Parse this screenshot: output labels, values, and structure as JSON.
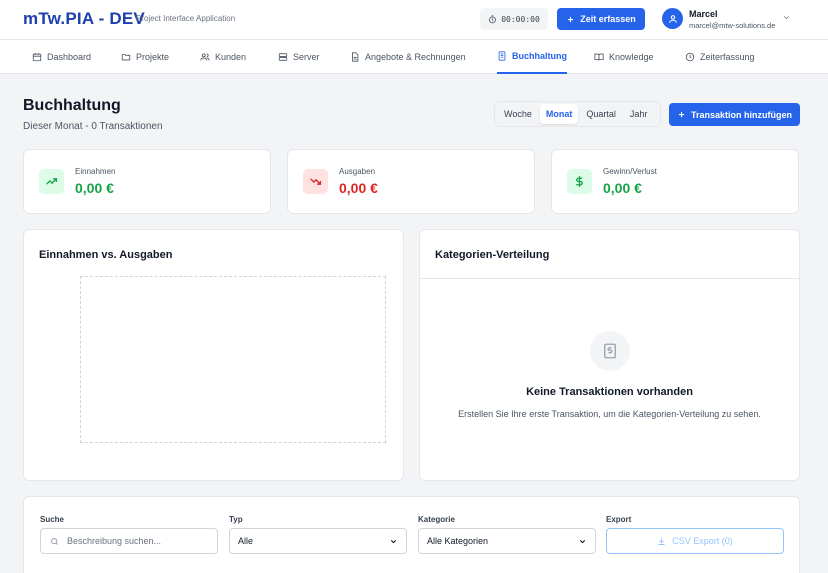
{
  "header": {
    "brand": "mTw.PIA - DEV",
    "brand_subtitle": "Project Interface Application",
    "timer": "00:00:00",
    "zeit_button": "Zeit erfassen",
    "user_name": "Marcel",
    "user_email": "marcel@mtw-solutions.de"
  },
  "nav": {
    "items": [
      {
        "label": "Dashboard",
        "icon": "calendar-icon"
      },
      {
        "label": "Projekte",
        "icon": "folder-icon"
      },
      {
        "label": "Kunden",
        "icon": "users-icon"
      },
      {
        "label": "Server",
        "icon": "server-icon"
      },
      {
        "label": "Angebote & Rechnungen",
        "icon": "document-icon"
      },
      {
        "label": "Buchhaltung",
        "icon": "receipt-icon"
      },
      {
        "label": "Knowledge",
        "icon": "book-icon"
      },
      {
        "label": "Zeiterfassung",
        "icon": "clock-icon"
      }
    ],
    "active": "Buchhaltung"
  },
  "page": {
    "title": "Buchhaltung",
    "subtitle": "Dieser Monat - 0 Transaktionen",
    "periods": [
      "Woche",
      "Monat",
      "Quartal",
      "Jahr"
    ],
    "active_period": "Monat",
    "add_button": "Transaktion hinzufügen"
  },
  "stats": [
    {
      "label": "Einnahmen",
      "value": "0,00 €",
      "color": "#16a34a",
      "bg": "#dcfce7",
      "icon": "trending-up-icon"
    },
    {
      "label": "Ausgaben",
      "value": "0,00 €",
      "color": "#dc2626",
      "bg": "#fee2e2",
      "icon": "trending-down-icon"
    },
    {
      "label": "Gewinn/Verlust",
      "value": "0,00 €",
      "color": "#16a34a",
      "bg": "#dcfce7",
      "icon": "dollar-icon"
    }
  ],
  "charts": {
    "income_vs_expense_title": "Einnahmen vs. Ausgaben",
    "category_title": "Kategorien-Verteilung",
    "empty_title": "Keine Transaktionen vorhanden",
    "empty_text": "Erstellen Sie Ihre erste Transaktion, um die Kategorien-Verteilung zu sehen."
  },
  "filters": {
    "search_label": "Suche",
    "search_placeholder": "Beschreibung suchen...",
    "type_label": "Typ",
    "type_value": "Alle",
    "category_label": "Kategorie",
    "category_value": "Alle Kategorien",
    "export_label": "Export",
    "export_button": "CSV Export (0)"
  },
  "colors": {
    "accent": "#2563eb",
    "brand": "#1e40af"
  }
}
